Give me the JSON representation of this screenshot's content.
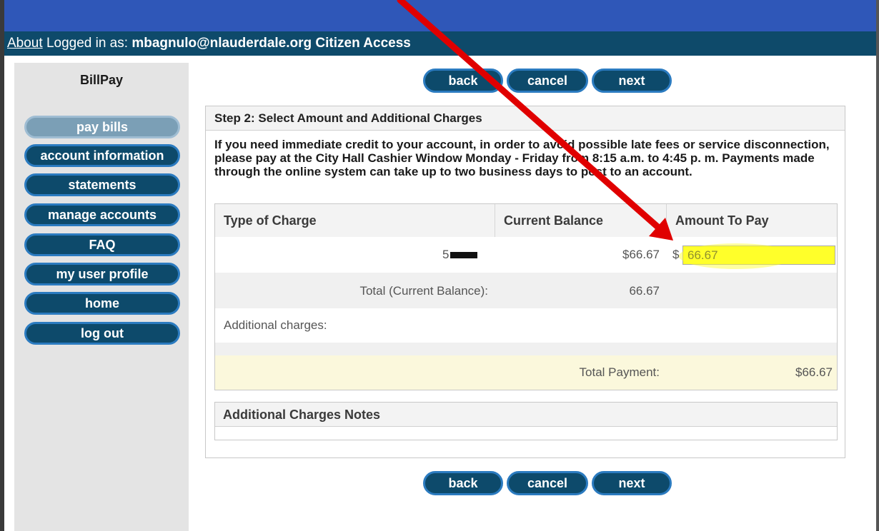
{
  "header": {
    "about_link": "About",
    "logged_in_prefix": "Logged in as:",
    "username": "mbagnulo@nlauderdale.org",
    "app_name": "Citizen Access"
  },
  "sidebar": {
    "title": "BillPay",
    "items": [
      {
        "label": "pay bills",
        "active": true
      },
      {
        "label": "account information"
      },
      {
        "label": "statements"
      },
      {
        "label": "manage accounts"
      },
      {
        "label": "FAQ"
      },
      {
        "label": "my user profile"
      },
      {
        "label": "home"
      },
      {
        "label": "log out"
      }
    ]
  },
  "actions": {
    "back": "back",
    "cancel": "cancel",
    "next": "next"
  },
  "step": {
    "title": "Step 2: Select Amount and Additional Charges",
    "intro": "If you need immediate credit to your account, in order to avoid possible late fees or service disconnection, please pay at the City Hall Cashier Window Monday - Friday from 8:15 a.m. to 4:45 p. m. Payments made through the online system can take up to two business days to post to an account."
  },
  "charges_table": {
    "headers": [
      "Type of Charge",
      "Current Balance",
      "Amount To Pay"
    ],
    "row": {
      "account_prefix": "5",
      "current_balance": "$66.67",
      "currency_symbol": "$",
      "amount_to_pay": "66.67"
    },
    "total_label": "Total (Current Balance):",
    "total_value": "66.67",
    "additional_label": "Additional charges:",
    "total_payment_label": "Total Payment:",
    "total_payment_value": "$66.67"
  },
  "notes": {
    "title": "Additional Charges Notes"
  },
  "colors": {
    "top_strip": "#2f57b8",
    "user_bar": "#0e4a6a",
    "button_fill": "#0d4a6b",
    "button_border": "#2b7bc0",
    "active_button": "#7b9fb6",
    "highlight": "#ffff2a",
    "annotation_arrow": "#e00000"
  }
}
